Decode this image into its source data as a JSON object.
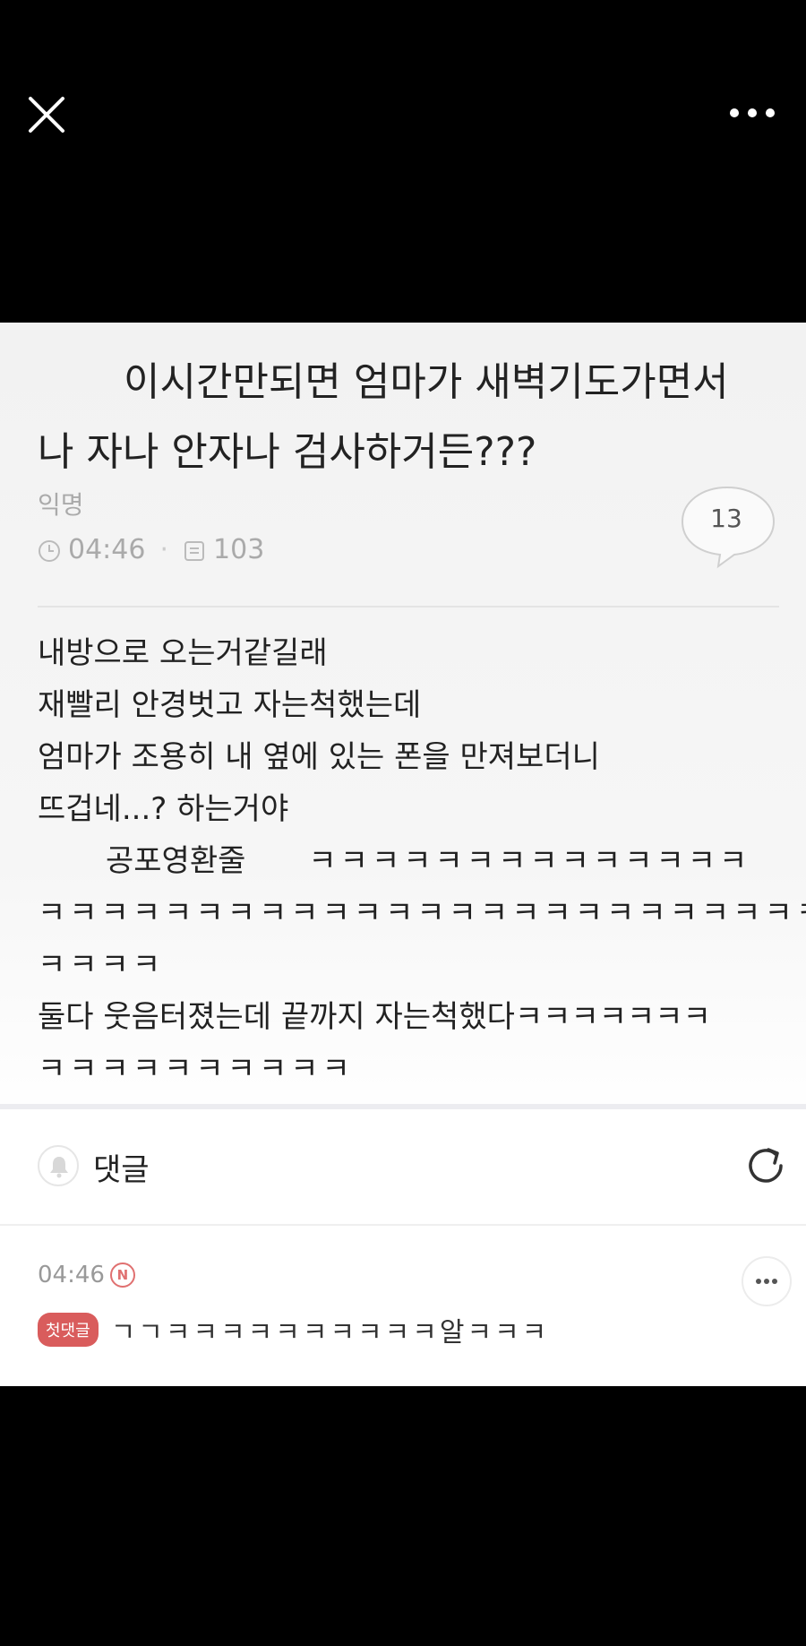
{
  "viewer": {
    "close_icon": "close-icon",
    "more_icon": "more-horizontal-icon"
  },
  "post": {
    "title_line1": "이시간만되면 엄마가 새벽기도가면서",
    "title_line2": "나 자나 안자나 검사하거든???",
    "author": "익명",
    "time": "04:46",
    "views": "103",
    "comment_count": "13",
    "body": [
      "내방으로 오는거같길래",
      "재빨리 안경벗고 자는척했는데",
      "엄마가 조용히 내 옆에 있는 폰을 만져보더니",
      "뜨겁네...? 하는거야"
    ],
    "line5_a": "공포영환줄",
    "line5_b": "ㅋㅋㅋㅋㅋㅋㅋㅋㅋㅋㅋㅋㅋㅋ",
    "line6": "ㅋㅋㅋㅋㅋㅋㅋㅋㅋㅋㅋㅋㅋㅋㅋㅋㅋㅋㅋㅋㅋㅋㅋㅋㅋ",
    "line7": "ㅋㅋㅋㅋ",
    "line8": "둘다 웃음터졌는데 끝까지 자는척했다ㅋㅋㅋㅋㅋㅋㅋ",
    "line9": "ㅋㅋㅋㅋㅋㅋㅋㅋㅋㅋ"
  },
  "comments": {
    "label": "댓글",
    "items": [
      {
        "time": "04:46",
        "new_badge": "N",
        "first_badge": "첫댓글",
        "text": "ㄱㄱㅋㅋㅋㅋㅋㅋㅋㅋㅋㅋ알ㅋㅋㅋ"
      }
    ]
  },
  "colors": {
    "background": "#000000",
    "card": "#f4f4f4",
    "accent_badge": "#d95c5c"
  }
}
